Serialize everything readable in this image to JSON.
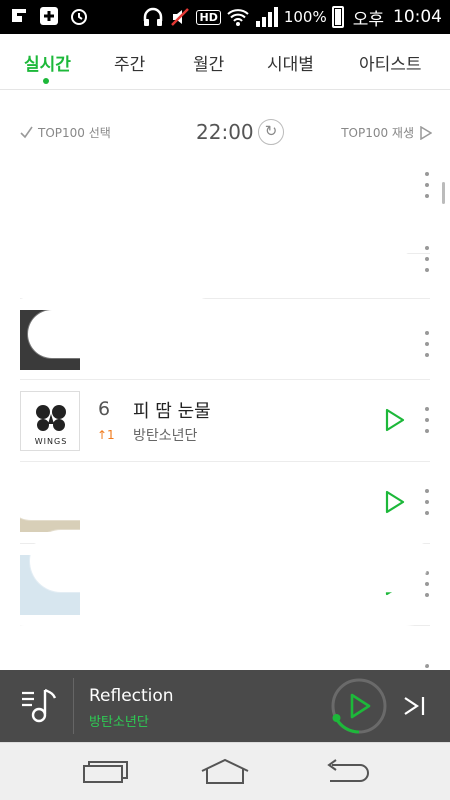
{
  "status_bar": {
    "battery": "100%",
    "ampm": "오후",
    "time": "10:04",
    "hd_label": "HD"
  },
  "tabs": [
    {
      "label": "실시간",
      "active": true
    },
    {
      "label": "주간",
      "active": false
    },
    {
      "label": "월간",
      "active": false
    },
    {
      "label": "시대별",
      "active": false
    },
    {
      "label": "아티스트",
      "active": false
    }
  ],
  "chart_header": {
    "select_label": "TOP100 선택",
    "time": "22:00",
    "play_all_label": "TOP100 재생"
  },
  "songs": [
    {
      "rank": "6",
      "change": "↑1",
      "title": "피 땀 눈물",
      "artist": "방탄소년단",
      "album_text": "WINGS"
    }
  ],
  "player": {
    "title": "Reflection",
    "artist": "방탄소년단"
  },
  "colors": {
    "accent": "#1db83a",
    "rank_up": "#f07b1e",
    "player_bg": "#4a4a4a"
  },
  "icons": [
    "check-icon",
    "refresh-icon",
    "play-icon",
    "more-icon",
    "playlist-icon",
    "next-icon",
    "recent-apps-icon",
    "home-icon",
    "back-icon"
  ]
}
